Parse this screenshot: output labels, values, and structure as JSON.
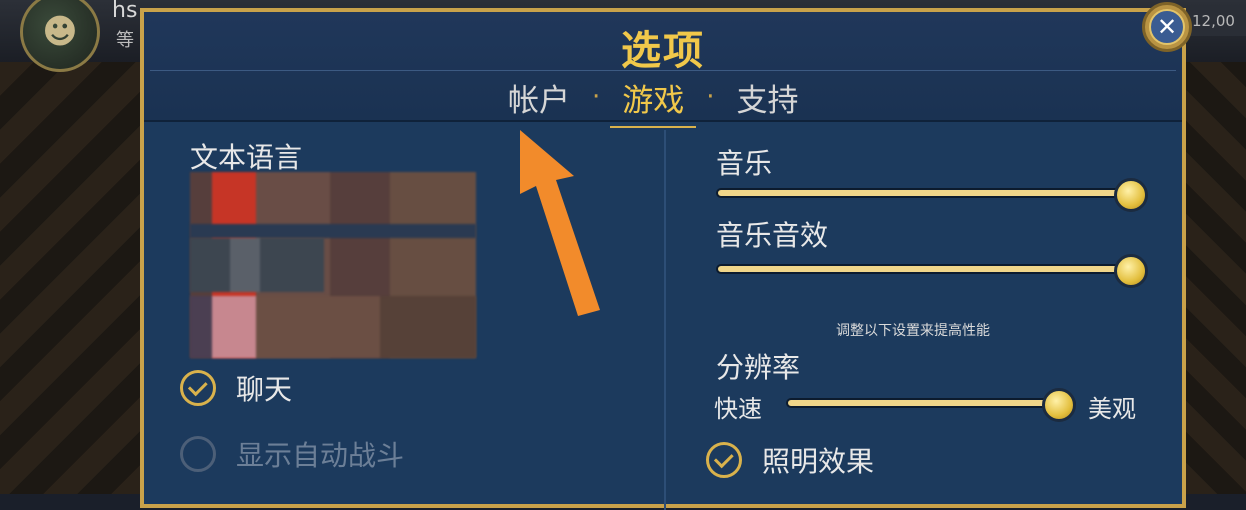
{
  "background": {
    "player_name": "hs",
    "player_sub": "等",
    "avatar_icon": "character-portrait",
    "currency": "12,00"
  },
  "dialog": {
    "title": "选项",
    "tabs": [
      {
        "label": "帐户",
        "active": false
      },
      {
        "label": "游戏",
        "active": true
      },
      {
        "label": "支持",
        "active": false
      }
    ],
    "tab_separator": "·",
    "close_icon": "close-icon"
  },
  "left": {
    "text_language_label": "文本语言",
    "chat": {
      "label": "聊天",
      "checked": true
    },
    "auto_battle": {
      "label": "显示自动战斗",
      "checked": false
    }
  },
  "right": {
    "music": {
      "label": "音乐",
      "value": 1.0
    },
    "sound_effects": {
      "label": "音乐音效",
      "value": 1.0
    },
    "performance_note": "调整以下设置来提高性能",
    "resolution": {
      "label": "分辨率",
      "min_label": "快速",
      "max_label": "美观",
      "value": 0.92
    },
    "lighting": {
      "label": "照明效果",
      "checked": true
    }
  },
  "colors": {
    "accent": "#f1c84a",
    "panel": "#1c3a5d",
    "border": "#c9a24a",
    "annotation_arrow": "#f28b2b"
  }
}
